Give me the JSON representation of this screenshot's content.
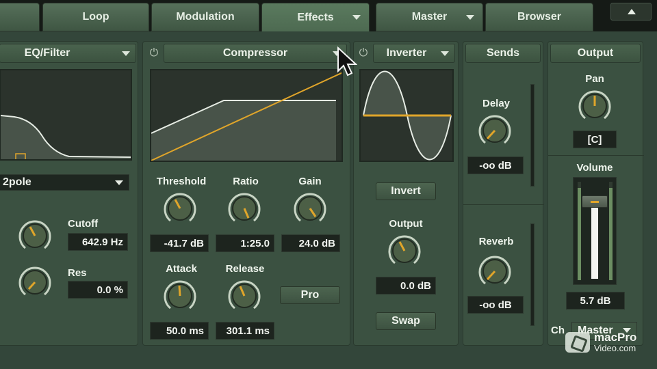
{
  "tabs": [
    {
      "label": "",
      "active": false
    },
    {
      "label": "Loop",
      "active": false
    },
    {
      "label": "Modulation",
      "active": false
    },
    {
      "label": "Effects",
      "active": true
    },
    {
      "label": "Master",
      "active": false
    },
    {
      "label": "Browser",
      "active": false
    }
  ],
  "eq": {
    "title": "EQ/Filter",
    "filter_type": "2pole",
    "cutoff_label": "Cutoff",
    "cutoff_value": "642.9 Hz",
    "res_label": "Res",
    "res_value": "0.0 %"
  },
  "compressor": {
    "title": "Compressor",
    "threshold_label": "Threshold",
    "threshold_value": "-41.7 dB",
    "ratio_label": "Ratio",
    "ratio_value": "1:25.0",
    "gain_label": "Gain",
    "gain_value": "24.0 dB",
    "attack_label": "Attack",
    "attack_value": "50.0 ms",
    "release_label": "Release",
    "release_value": "301.1 ms",
    "pro_label": "Pro"
  },
  "inverter": {
    "title": "Inverter",
    "invert_label": "Invert",
    "output_label": "Output",
    "output_value": "0.0 dB",
    "swap_label": "Swap"
  },
  "sends": {
    "title": "Sends",
    "delay_label": "Delay",
    "delay_value": "-oo dB",
    "reverb_label": "Reverb",
    "reverb_value": "-oo dB"
  },
  "output": {
    "title": "Output",
    "pan_label": "Pan",
    "pan_value": "[C]",
    "volume_label": "Volume",
    "volume_value": "5.7 dB",
    "ch_label": "Ch",
    "ch_value": "Master"
  },
  "watermark": {
    "line1": "macPro",
    "line2": "Video.com"
  },
  "colors": {
    "accent": "#e0a52a",
    "panel": "#3b5141",
    "display": "#2a342c"
  }
}
